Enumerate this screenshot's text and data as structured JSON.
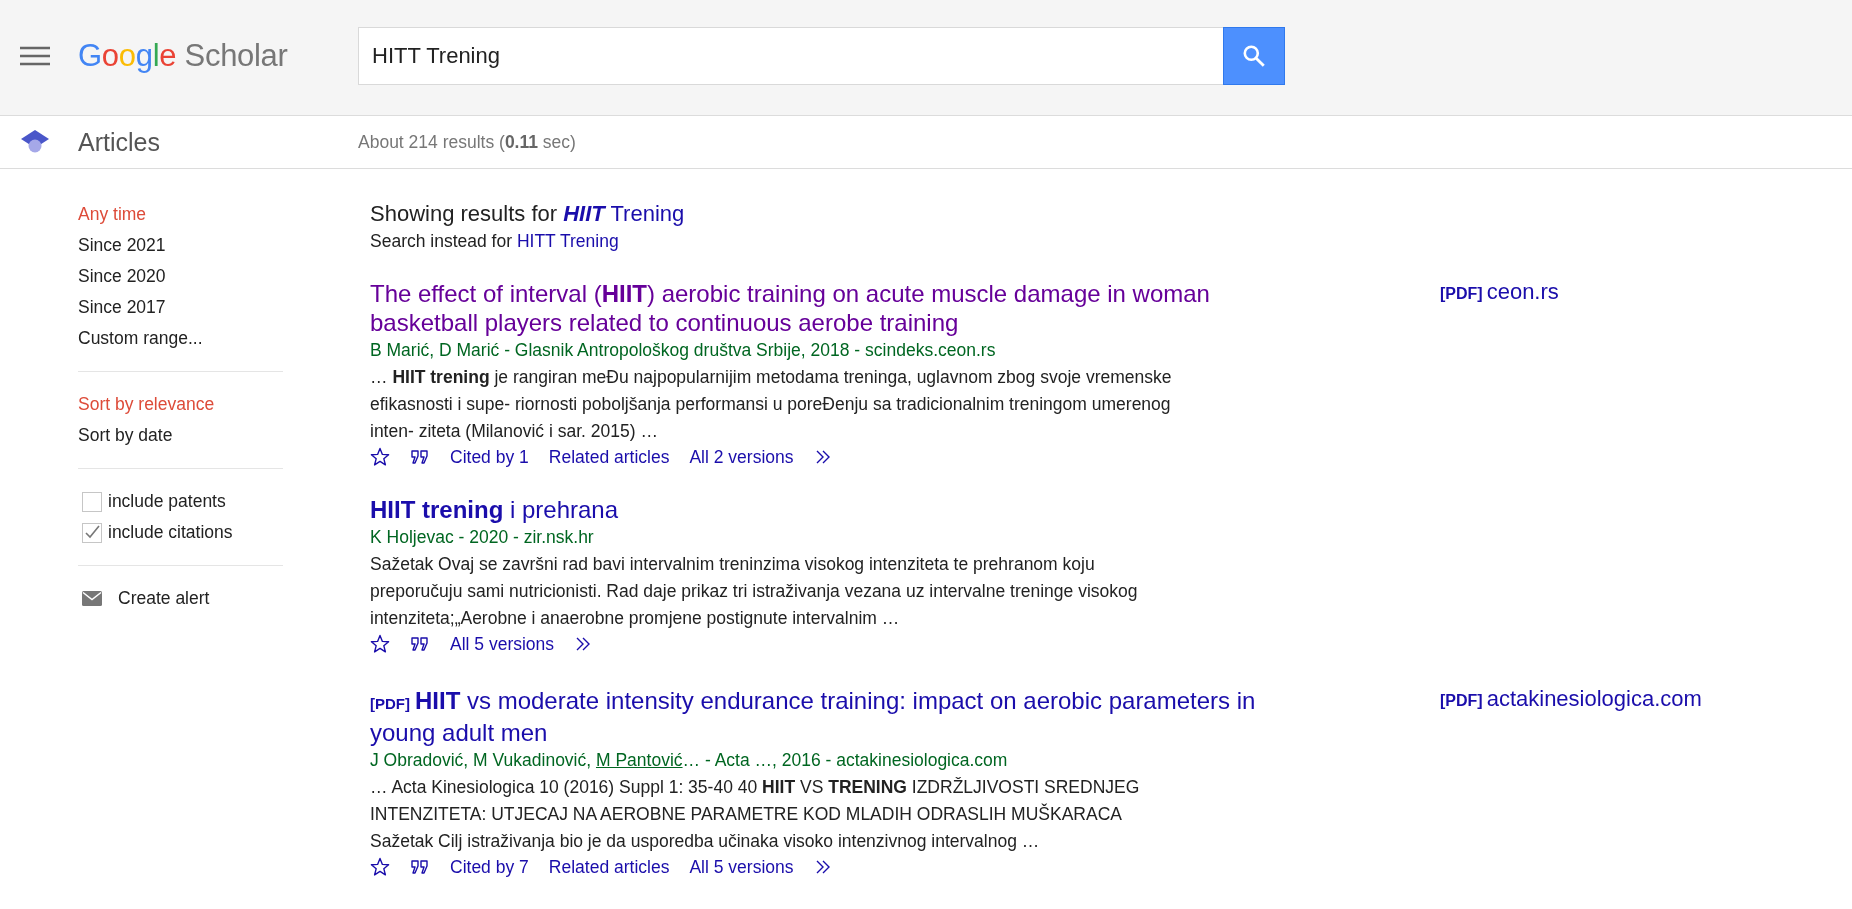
{
  "header": {
    "logo": {
      "brand": "Google",
      "product": "Scholar"
    },
    "search": {
      "value": "HITT Trening"
    }
  },
  "subheader": {
    "section": "Articles",
    "stats": "About 214 results (**0.11** sec)"
  },
  "sidebar": {
    "time_filters": [
      {
        "label": "Any time",
        "selected": true
      },
      {
        "label": "Since 2021",
        "selected": false
      },
      {
        "label": "Since 2020",
        "selected": false
      },
      {
        "label": "Since 2017",
        "selected": false
      },
      {
        "label": "Custom range...",
        "selected": false
      }
    ],
    "sort": [
      {
        "label": "Sort by relevance",
        "selected": true
      },
      {
        "label": "Sort by date",
        "selected": false
      }
    ],
    "options": [
      {
        "label": "include patents",
        "checked": false
      },
      {
        "label": "include citations",
        "checked": true
      }
    ],
    "alert": "Create alert"
  },
  "correction": {
    "lead": "Showing results for ",
    "query": "**HIIT** Trening",
    "alt_lead": "Search instead for ",
    "alt_query": "HITT Trening"
  },
  "results": [
    {
      "visited": true,
      "title": "The effect of interval (**HIIT**) aerobic training on acute muscle damage in woman basketball players related to continuous aerobe training",
      "byline": [
        {
          "text": "B Marić, D Marić - Glasnik Antropološkog društva Srbije, 2018 - scindeks.ceon.rs",
          "link": false
        }
      ],
      "snippet": "… **HIIT trening** je rangiran meĐu najpopularnijim metodama treninga, uglavnom zbog svoje vremenske efikasnosti i supe- riornosti poboljšanja performansi u poreĐenju sa tradicionalnim treningom umerenog inten- ziteta (Milanović i sar. 2015) …",
      "links": [
        "Cited by 1",
        "Related articles",
        "All 2 versions"
      ],
      "side": {
        "tag": "[PDF]",
        "site": "ceon.rs"
      }
    },
    {
      "visited": false,
      "title": "**HIIT trening** i prehrana",
      "byline": [
        {
          "text": "K Holjevac - 2020 - zir.nsk.hr",
          "link": false
        }
      ],
      "snippet": "Sažetak Ovaj se završni rad bavi intervalnim treninzima visokog intenziteta te prehranom koju preporučuju sami nutricionisti. Rad daje prikaz tri istraživanja vezana uz intervalne treninge visokog intenziteta;„Aerobne i anaerobne promjene postignute intervalnim …",
      "links": [
        "All 5 versions"
      ]
    },
    {
      "visited": false,
      "tag": "[PDF]",
      "title": "**HIIT** vs moderate intensity endurance training: impact on aerobic parameters in young adult men",
      "byline": [
        {
          "text": "J Obradović, M Vukadinović, ",
          "link": false
        },
        {
          "text": "M Pantović",
          "link": true
        },
        {
          "text": "… - Acta …, 2016 - actakinesiologica.com",
          "link": false
        }
      ],
      "snippet": "… Acta Kinesiologica 10 (2016) Suppl 1: 35-40 40 **HIIT** VS **TRENING** IZDRŽLJIVOSTI SREDNJEG INTENZITETA: UTJECAJ NA AEROBNE PARAMETRE KOD MLADIH ODRASLIH MUŠKARACA Sažetak Cilj istraživanja bio je da usporedba učinaka visoko intenzivnog intervalnog …",
      "links": [
        "Cited by 7",
        "Related articles",
        "All 5 versions"
      ],
      "side": {
        "tag": "[PDF]",
        "site": "actakinesiologica.com"
      }
    }
  ]
}
